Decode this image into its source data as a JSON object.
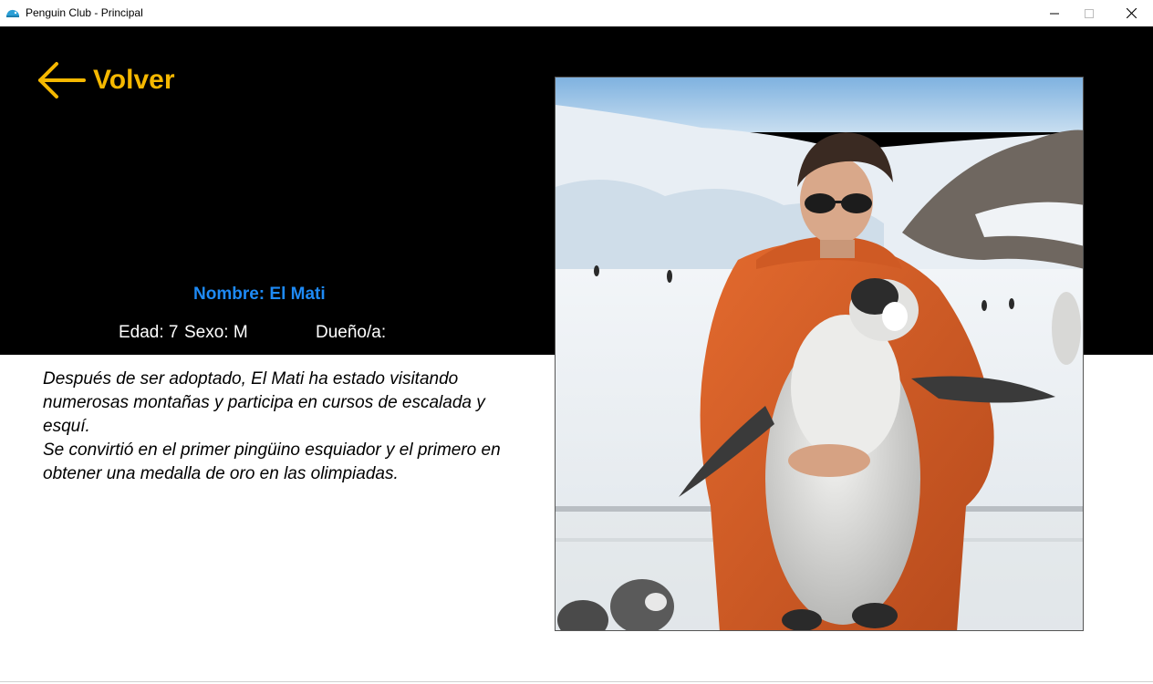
{
  "window": {
    "title": "Penguin Club - Principal",
    "minimize_glyph": "—",
    "maximize_glyph": "☐",
    "close_glyph": "✕"
  },
  "header": {
    "back_label": "Volver",
    "accent_color": "#f5b800"
  },
  "penguin": {
    "name_line": "Nombre: El Mati",
    "edad_line": "Edad: 7",
    "sexo_line": "Sexo: M",
    "duenio_line": "Dueño/a:",
    "name_color": "#1e8af5"
  },
  "description": {
    "paragraph_1": "Después de ser adoptado, El Mati ha estado visitando numerosas montañas y participa en cursos de escalada y esquí.",
    "paragraph_2": "Se convirtió en el primer pingüino esquiador y el primero en obtener una medalla de oro en las olimpiadas."
  },
  "photo": {
    "icon": "photo-person-holding-penguin"
  }
}
